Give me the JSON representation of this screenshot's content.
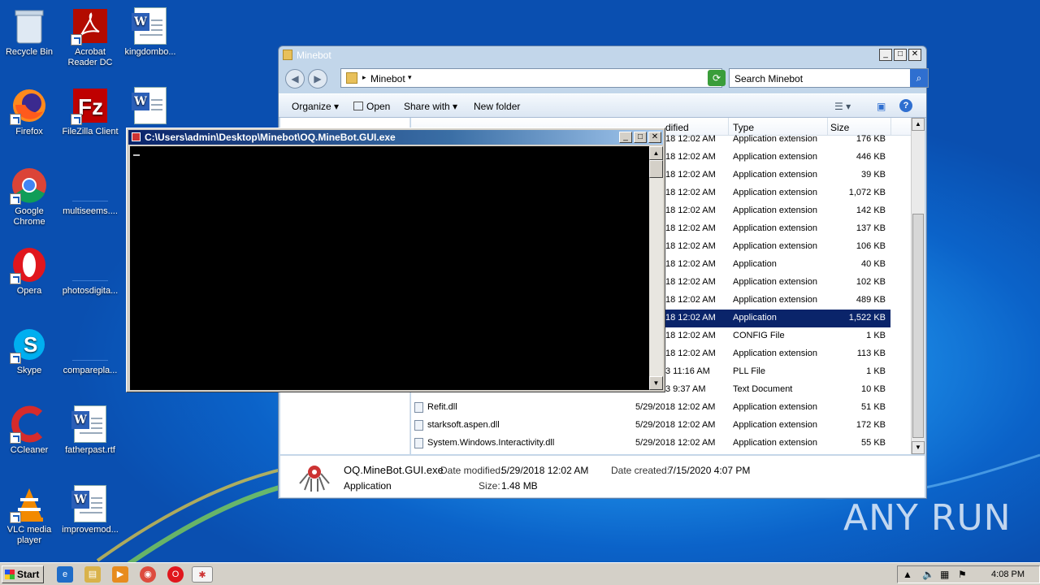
{
  "desktop": {
    "icons": [
      {
        "label": "Recycle Bin"
      },
      {
        "label": "Acrobat Reader DC"
      },
      {
        "label": "kingdombo..."
      },
      {
        "label": "Firefox"
      },
      {
        "label": "FileZilla Client"
      },
      {
        "label": "Google Chrome"
      },
      {
        "label": "multiseems...."
      },
      {
        "label": "Opera"
      },
      {
        "label": "photosdigita..."
      },
      {
        "label": "Skype"
      },
      {
        "label": "compareplа..."
      },
      {
        "label": "CCleaner"
      },
      {
        "label": "fatherpast.rtf"
      },
      {
        "label": "VLC media player"
      },
      {
        "label": "improvemod..."
      }
    ]
  },
  "explorer": {
    "title": "Minebot",
    "address": "Minebot",
    "search_placeholder": "Search Minebot",
    "toolbar": {
      "organize": "Organize",
      "open": "Open",
      "share": "Share with",
      "new_folder": "New folder"
    },
    "columns": {
      "modified": "dified",
      "type": "Type",
      "size": "Size"
    },
    "rows": [
      {
        "name": "",
        "date": "18 12:02 AM",
        "type": "Application extension",
        "size": "176 KB"
      },
      {
        "name": "",
        "date": "18 12:02 AM",
        "type": "Application extension",
        "size": "446 KB"
      },
      {
        "name": "",
        "date": "18 12:02 AM",
        "type": "Application extension",
        "size": "39 KB"
      },
      {
        "name": "",
        "date": "18 12:02 AM",
        "type": "Application extension",
        "size": "1,072 KB"
      },
      {
        "name": "",
        "date": "18 12:02 AM",
        "type": "Application extension",
        "size": "142 KB"
      },
      {
        "name": "",
        "date": "18 12:02 AM",
        "type": "Application extension",
        "size": "137 KB"
      },
      {
        "name": "",
        "date": "18 12:02 AM",
        "type": "Application extension",
        "size": "106 KB"
      },
      {
        "name": "",
        "date": "18 12:02 AM",
        "type": "Application",
        "size": "40 KB"
      },
      {
        "name": "",
        "date": "18 12:02 AM",
        "type": "Application extension",
        "size": "102 KB"
      },
      {
        "name": "",
        "date": "18 12:02 AM",
        "type": "Application extension",
        "size": "489 KB"
      },
      {
        "name": "",
        "date": "18 12:02 AM",
        "type": "Application",
        "size": "1,522 KB"
      },
      {
        "name": "",
        "date": "18 12:02 AM",
        "type": "CONFIG File",
        "size": "1 KB"
      },
      {
        "name": "",
        "date": "18 12:02 AM",
        "type": "Application extension",
        "size": "113 KB"
      },
      {
        "name": "",
        "date": "3 11:16 AM",
        "type": "PLL File",
        "size": "1 KB"
      },
      {
        "name": "",
        "date": "3 9:37 AM",
        "type": "Text Document",
        "size": "10 KB"
      },
      {
        "name": "Refit.dll",
        "date": "5/29/2018 12:02 AM",
        "type": "Application extension",
        "size": "51 KB"
      },
      {
        "name": "starksoft.aspen.dll",
        "date": "5/29/2018 12:02 AM",
        "type": "Application extension",
        "size": "172 KB"
      },
      {
        "name": "System.Windows.Interactivity.dll",
        "date": "5/29/2018 12:02 AM",
        "type": "Application extension",
        "size": "55 KB"
      }
    ],
    "selected_index": 10,
    "details": {
      "filename": "OQ.MineBot.GUI.exe",
      "kind": "Application",
      "modified_label": "Date modified:",
      "modified_value": "5/29/2018 12:02 AM",
      "size_label": "Size:",
      "size_value": "1.48 MB",
      "created_label": "Date created:",
      "created_value": "7/15/2020 4:07 PM"
    }
  },
  "console": {
    "title": "C:\\Users\\admin\\Desktop\\Minebot\\OQ.MineBot.GUI.exe"
  },
  "taskbar": {
    "start": "Start",
    "clock": "4:08 PM"
  },
  "watermark": "ANY RUN"
}
